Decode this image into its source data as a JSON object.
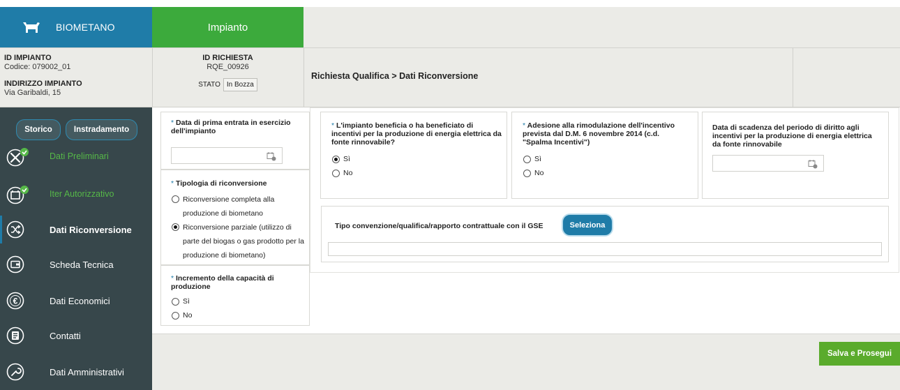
{
  "header": {
    "brand_label": "BIOMETANO",
    "tab_label": "Impianto",
    "colors": {
      "brand": "#1f7ca8",
      "tab": "#3caa3c",
      "accent_green": "#5aab2c"
    }
  },
  "info": {
    "id_impianto_label": "ID IMPIANTO",
    "id_impianto_value": "Codice: 079002_01",
    "indirizzo_label": "INDIRIZZO IMPIANTO",
    "indirizzo_value": "Via Garibaldi, 15",
    "id_richiesta_label": "ID RICHIESTA",
    "id_richiesta_value": "RQE_00926",
    "stato_label": "STATO",
    "stato_value": "In Bozza",
    "breadcrumb": "Richiesta Qualifica > Dati Riconversione"
  },
  "sidebar": {
    "buttons": {
      "storico": "Storico",
      "instradamento": "Instradamento"
    },
    "items": [
      {
        "label": "Dati Preliminari",
        "icon": "tools-icon",
        "state": "done"
      },
      {
        "label": "Iter Autorizzativo",
        "icon": "calendar-icon",
        "state": "done"
      },
      {
        "label": "Dati Riconversione",
        "icon": "shuffle-icon",
        "state": "active"
      },
      {
        "label": "Scheda Tecnica",
        "icon": "wallet-icon",
        "state": "normal"
      },
      {
        "label": "Dati Economici",
        "icon": "euro-icon",
        "state": "normal"
      },
      {
        "label": "Contatti",
        "icon": "contacts-icon",
        "state": "normal"
      },
      {
        "label": "Dati Amministrativi",
        "icon": "wrench-icon",
        "state": "normal"
      }
    ]
  },
  "form": {
    "required_mark": "*",
    "data_prima_entrata": {
      "label": "Data di prima entrata in esercizio dell'impianto",
      "value": ""
    },
    "tipologia": {
      "label": "Tipologia di riconversione",
      "option_completa": "Riconversione completa alla produzione di biometano",
      "option_parziale": "Riconversione parziale (utilizzo di parte del biogas o gas prodotto per la produzione di biometano)",
      "selected": "parziale"
    },
    "incremento": {
      "label": "Incremento della capacità di produzione",
      "option_si": "Sì",
      "option_no": "No",
      "selected": ""
    },
    "incentivi": {
      "label": "L'impianto beneficia o ha beneficiato di incentivi per la produzione di energia elettrica da fonte rinnovabile?",
      "option_si": "Sì",
      "option_no": "No",
      "selected": "si"
    },
    "spalma": {
      "label": "Adesione alla rimodulazione dell'incentivo prevista dal D.M. 6 novembre 2014 (c.d. \"Spalma Incentivi\")",
      "option_si": "Sì",
      "option_no": "No",
      "selected": ""
    },
    "scadenza": {
      "label": "Data di scadenza del periodo di diritto agli incentivi per la produzione di energia elettrica da fonte rinnovabile",
      "value": ""
    },
    "convenzione": {
      "label": "Tipo convenzione/qualifica/rapporto contrattuale con il GSE",
      "button": "Seleziona",
      "value": ""
    }
  },
  "footer": {
    "save_label": "Salva e Prosegui"
  }
}
